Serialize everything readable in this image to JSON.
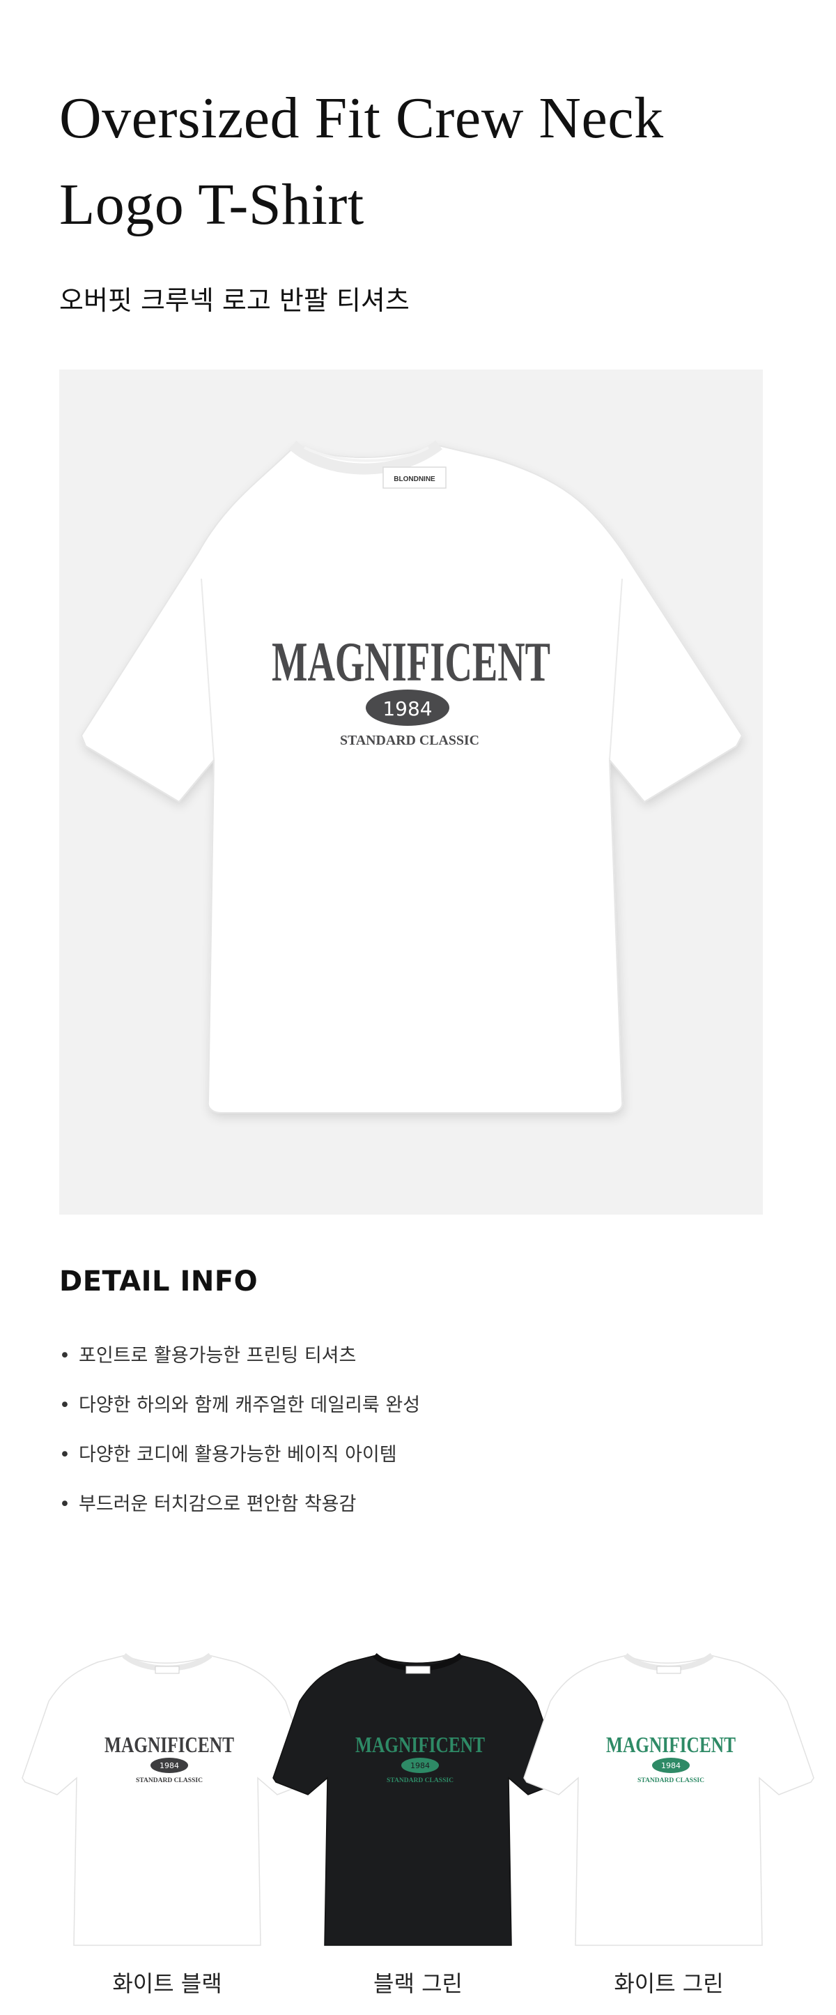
{
  "product": {
    "title_line1": "Oversized Fit Crew Neck",
    "title_line2": "Logo T-Shirt",
    "subtitle": "오버핏 크루넥 로고 반팔 티셔츠"
  },
  "hero": {
    "tag_text": "BLONDNINE",
    "print_main": "MAGNIFICENT",
    "print_year": "1984",
    "print_sub": "STANDARD CLASSIC",
    "shirt_color": "#ffffff",
    "print_color": "#4a4a4c"
  },
  "detail": {
    "heading": "DETAIL INFO",
    "items": [
      "포인트로 활용가능한 프린팅 티셔츠",
      "다양한 하의와 함께 캐주얼한 데일리룩 완성",
      "다양한 코디에 활용가능한 베이직 아이템",
      "부드러운 터치감으로 편안함 착용감"
    ]
  },
  "variants": [
    {
      "label": "화이트 블랙",
      "shirt_color": "#ffffff",
      "print_color": "#3d3d3f",
      "print_main": "MAGNIFICENT",
      "print_year": "1984",
      "print_sub": "STANDARD CLASSIC"
    },
    {
      "label": "블랙 그린",
      "shirt_color": "#1b1c1e",
      "print_color": "#2e8a66",
      "print_main": "MAGNIFICENT",
      "print_year": "1984",
      "print_sub": "STANDARD CLASSIC"
    },
    {
      "label": "화이트 그린",
      "shirt_color": "#ffffff",
      "print_color": "#2e8a66",
      "print_main": "MAGNIFICENT",
      "print_year": "1984",
      "print_sub": "STANDARD CLASSIC"
    }
  ]
}
